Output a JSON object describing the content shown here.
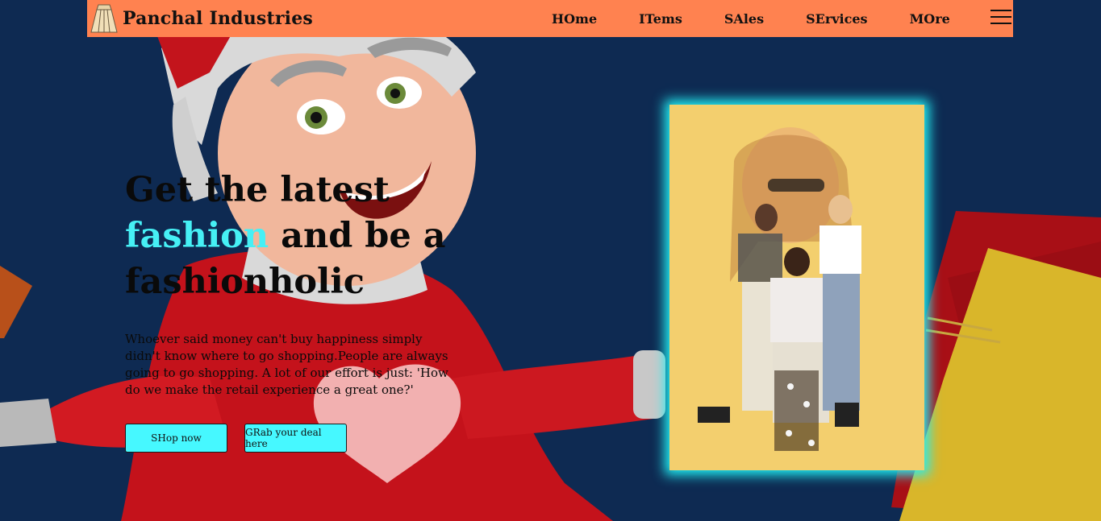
{
  "navbar": {
    "brand": "Panchal Industries",
    "logo_icon": "skirt-logo-icon",
    "links": [
      "HOme",
      "ITems",
      "SAles",
      "SErvices",
      "MOre"
    ],
    "menu_icon": "hamburger-menu-icon"
  },
  "hero": {
    "title_line1": "Get the latest",
    "title_accent": "fashion",
    "title_rest": " and be a fashionholic",
    "description": "Whoever said money can't buy happiness simply didn't know where to go shopping.People are always going to go shopping. A lot of our effort is just: 'How do we make the retail experience a great one?'",
    "buttons": {
      "shop": "SHop now",
      "deal": "GRab your deal here"
    }
  },
  "colors": {
    "background": "#0e2a52",
    "navbar": "#ff8250",
    "accent": "#46f0f5",
    "button": "#46f8ff",
    "card_glow": "#22f0f5"
  }
}
